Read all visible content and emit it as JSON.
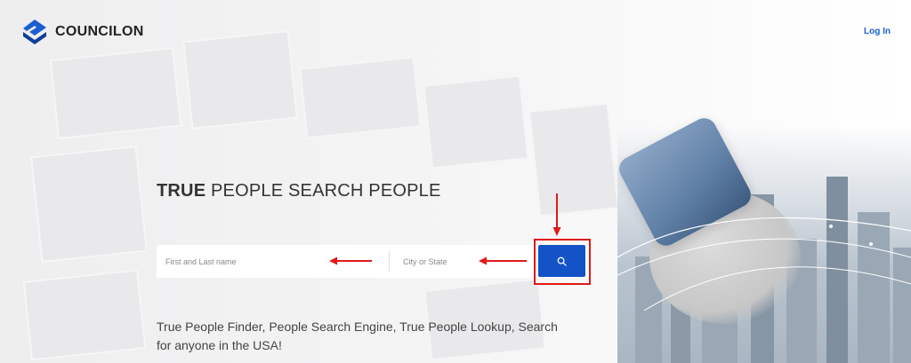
{
  "header": {
    "brand": "COUNCILON",
    "login_label": "Log In"
  },
  "hero": {
    "title_bold": "TRUE",
    "title_rest": " PEOPLE SEARCH PEOPLE",
    "tagline": "True People Finder, People Search Engine, True People Lookup, Search for anyone in the USA!"
  },
  "search": {
    "name_placeholder": "First and Last name",
    "city_placeholder": "City or State",
    "button_icon": "search-icon"
  },
  "colors": {
    "brand_blue": "#1352c7",
    "logo_blue": "#1a5fd1",
    "annotation_red": "#e01919"
  }
}
